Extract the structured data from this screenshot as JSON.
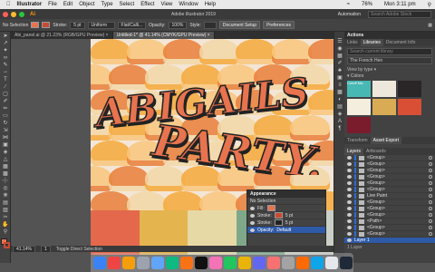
{
  "menubar": {
    "app": "Illustrator",
    "items": [
      "File",
      "Edit",
      "Object",
      "Type",
      "Select",
      "Effect",
      "View",
      "Window",
      "Help"
    ],
    "battery": "76%",
    "clock": "Mon 3:11 pm"
  },
  "titlebar": {
    "title": "Adobe Illustrator 2019",
    "workspace": "Automation",
    "search_placeholder": "Search Adobe Stock"
  },
  "controlbar": {
    "selection": "No Selection",
    "stroke_label": "Stroke:",
    "stroke_value": "5 pt",
    "profile": "Uniform",
    "brush": "Flat/Calli...",
    "opacity_label": "Opacity:",
    "opacity_value": "100%",
    "style_label": "Style:",
    "document_setup": "Document Setup",
    "preferences": "Preferences",
    "fill_color": "#e8734f",
    "stroke_color": "#c94a32"
  },
  "tabs": [
    {
      "label": "Abi_panel.ai @ 21.23% (RGB/GPU Preview)",
      "active": false
    },
    {
      "label": "Untitled-1* @ 41.14% (CMYK/GPU Preview)",
      "active": true
    }
  ],
  "artwork": {
    "bg": "#f3e6d6",
    "petal_colors": [
      "#f6a93b",
      "#f9c77e",
      "#e97f3a",
      "#f3d9a8"
    ],
    "stripe_colors": [
      "#e3684c",
      "#e4b44f",
      "#e7d9a6",
      "#7fa88a",
      "#c9cfc6"
    ]
  },
  "panels": {
    "actions": "Actions",
    "tabs": [
      "Links",
      "Libraries",
      "Document Info"
    ],
    "active_tab": "Libraries",
    "search_placeholder": "Search current library",
    "library_name": "The French Hen",
    "view_by": "View by type",
    "section": "Colors",
    "swatch_names": [
      "Cutoff Ma..."
    ],
    "swatches": [
      "#47b8b4",
      "#eee8dc",
      "#2a2627",
      "#f4eedf",
      "#d9ab54",
      "#d84f36",
      "#7a1c2c"
    ],
    "lower_tabs": [
      "Transform",
      "Asset Export"
    ],
    "layers_tabs": [
      "Layers",
      "Artboards"
    ],
    "layers": [
      "<Group>",
      "<Group>",
      "<Group>",
      "<Group>",
      "<Group>",
      "<Group>",
      "Live Paint",
      "<Group>",
      "<Group>",
      "<Group>",
      "<Path>",
      "<Group>",
      "<Group>"
    ],
    "top_layer": "Layer 1",
    "layer_count": "1 Layer"
  },
  "appearance": {
    "title": "Appearance",
    "selection": "No Selection",
    "rows": [
      {
        "label": "Fill:",
        "value": ""
      },
      {
        "label": "Stroke:",
        "value": "5 pt"
      },
      {
        "label": "Stroke:",
        "value": "5 pt"
      },
      {
        "label": "Opacity:",
        "value": "Default"
      }
    ]
  },
  "status": {
    "zoom": "41.14%",
    "artboard": "1",
    "tool": "Toggle Direct Selection"
  },
  "dock_colors": [
    "#3b82f6",
    "#ef4444",
    "#f59e0b",
    "#9ca3af",
    "#60a5fa",
    "#10b981",
    "#f97316",
    "#111111",
    "#f472b6",
    "#22c55e",
    "#eab308",
    "#6366f1",
    "#f87171",
    "#a3a3a3",
    "#ff6a00",
    "#0ea5e9",
    "#e5e7eb",
    "#1f2937"
  ]
}
